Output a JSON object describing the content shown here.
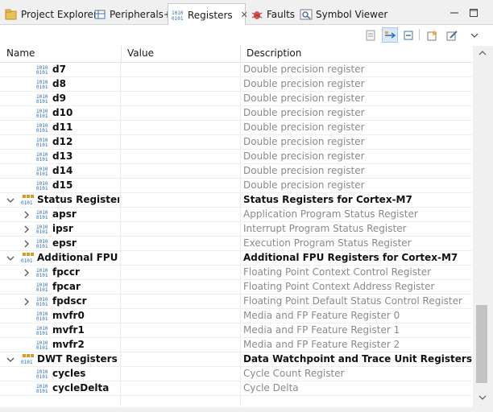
{
  "tabs": [
    {
      "label": "Project Explorer",
      "icon": "project-explorer-icon"
    },
    {
      "label": "Peripherals+",
      "icon": "peripherals-icon"
    },
    {
      "label": "Registers",
      "icon": "registers-icon",
      "active": true
    },
    {
      "label": "Faults",
      "icon": "bug-icon"
    },
    {
      "label": "Symbol Viewer",
      "icon": "symbol-viewer-icon"
    }
  ],
  "columns": {
    "name": "Name",
    "value": "Value",
    "description": "Description"
  },
  "rows": [
    {
      "name": "d7",
      "value": "",
      "description": "Double precision register",
      "kind": "reg",
      "level": 1
    },
    {
      "name": "d8",
      "value": "",
      "description": "Double precision register",
      "kind": "reg",
      "level": 1
    },
    {
      "name": "d9",
      "value": "",
      "description": "Double precision register",
      "kind": "reg",
      "level": 1
    },
    {
      "name": "d10",
      "value": "",
      "description": "Double precision register",
      "kind": "reg",
      "level": 1
    },
    {
      "name": "d11",
      "value": "",
      "description": "Double precision register",
      "kind": "reg",
      "level": 1
    },
    {
      "name": "d12",
      "value": "",
      "description": "Double precision register",
      "kind": "reg",
      "level": 1
    },
    {
      "name": "d13",
      "value": "",
      "description": "Double precision register",
      "kind": "reg",
      "level": 1
    },
    {
      "name": "d14",
      "value": "",
      "description": "Double precision register",
      "kind": "reg",
      "level": 1
    },
    {
      "name": "d15",
      "value": "",
      "description": "Double precision register",
      "kind": "reg",
      "level": 1
    },
    {
      "name": "Status Registers",
      "value": "",
      "description": "Status Registers for Cortex-M7",
      "kind": "group",
      "level": 0
    },
    {
      "name": "apsr",
      "value": "",
      "description": "Application Program Status Register",
      "kind": "reg",
      "level": 1,
      "expandable": true
    },
    {
      "name": "ipsr",
      "value": "",
      "description": "Interrupt Program Status Register",
      "kind": "reg",
      "level": 1,
      "expandable": true
    },
    {
      "name": "epsr",
      "value": "",
      "description": "Execution Program Status Register",
      "kind": "reg",
      "level": 1,
      "expandable": true
    },
    {
      "name": "Additional FPU Reg",
      "value": "",
      "description": "Additional FPU Registers for Cortex-M7",
      "kind": "group",
      "level": 0
    },
    {
      "name": "fpccr",
      "value": "",
      "description": "Floating Point Context Control Register",
      "kind": "reg",
      "level": 1,
      "expandable": true
    },
    {
      "name": "fpcar",
      "value": "",
      "description": "Floating Point Context Address Register",
      "kind": "reg",
      "level": 1
    },
    {
      "name": "fpdscr",
      "value": "",
      "description": "Floating Point Default Status Control Register",
      "kind": "reg",
      "level": 1,
      "expandable": true
    },
    {
      "name": "mvfr0",
      "value": "",
      "description": "Media and FP Feature Register 0",
      "kind": "reg",
      "level": 1
    },
    {
      "name": "mvfr1",
      "value": "",
      "description": "Media and FP Feature Register 1",
      "kind": "reg",
      "level": 1
    },
    {
      "name": "mvfr2",
      "value": "",
      "description": "Media and FP Feature Register 2",
      "kind": "reg",
      "level": 1
    },
    {
      "name": "DWT Registers",
      "value": "",
      "description": "Data Watchpoint and Trace Unit Registers",
      "kind": "group",
      "level": 0
    },
    {
      "name": "cycles",
      "value": "",
      "description": "Cycle Count Register",
      "kind": "reg",
      "level": 1
    },
    {
      "name": "cycleDelta",
      "value": "",
      "description": "Cycle Delta",
      "kind": "reg",
      "level": 1
    }
  ],
  "colors": {
    "accent": "#dbe9f7",
    "description_text": "#8a8a8a",
    "register_icon": "#2b6cb0"
  }
}
